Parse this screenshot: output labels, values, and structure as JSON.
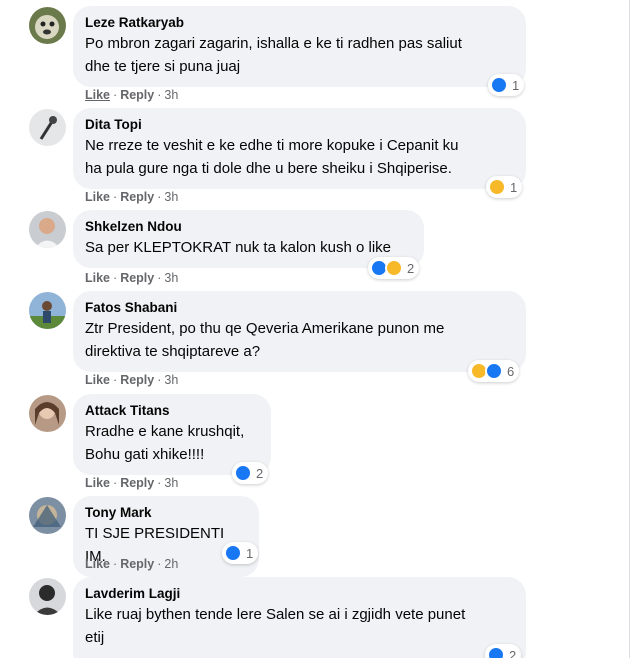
{
  "actions": {
    "like": "Like",
    "reply": "Reply",
    "dot": "·"
  },
  "colors": {
    "like_blue": "#1877f2",
    "haha_yellow": "#f7b928",
    "bubble_bg": "#f0f2f5",
    "meta_gray": "#65676b"
  },
  "comments": [
    {
      "author": "Leze Ratkaryab",
      "text": "Po mbron zagari zagarin, ishalla e ke ti radhen pas saliut\ndhe te tjere si puna juaj",
      "time": "3h",
      "reactions": [
        "like-icon"
      ],
      "reaction_count": "1"
    },
    {
      "author": "Dita Topi",
      "text": "Ne rreze te veshit e ke edhe ti more kopuke i Cepanit ku\nha pula gure nga ti dole dhe u bere sheiku i Shqiperise.",
      "time": "3h",
      "reactions": [
        "haha-icon"
      ],
      "reaction_count": "1"
    },
    {
      "author": "Shkelzen Ndou",
      "text": "Sa per KLEPTOKRAT nuk ta kalon kush o like",
      "time": "3h",
      "reactions": [
        "like-icon",
        "haha-icon"
      ],
      "reaction_count": "2"
    },
    {
      "author": "Fatos Shabani",
      "text": "Ztr President, po thu qe Qeveria Amerikane punon me\ndirektiva te shqiptareve a?",
      "time": "3h",
      "reactions": [
        "haha-icon",
        "like-icon"
      ],
      "reaction_count": "6"
    },
    {
      "author": "Attack Titans",
      "text": "Rradhe e kane krushqit,\nBohu gati xhike!!!!",
      "time": "3h",
      "reactions": [
        "like-icon"
      ],
      "reaction_count": "2"
    },
    {
      "author": "Tony Mark",
      "text": "TI SJE PRESIDENTI IM.",
      "time": "2h",
      "reactions": [
        "like-icon"
      ],
      "reaction_count": "1"
    },
    {
      "author": "Lavderim Lagji",
      "text": "Like ruaj bythen tende lere Salen se ai i zgjidh vete punet\netij",
      "time": "",
      "reactions": [
        "like-icon"
      ],
      "reaction_count": "2"
    }
  ]
}
